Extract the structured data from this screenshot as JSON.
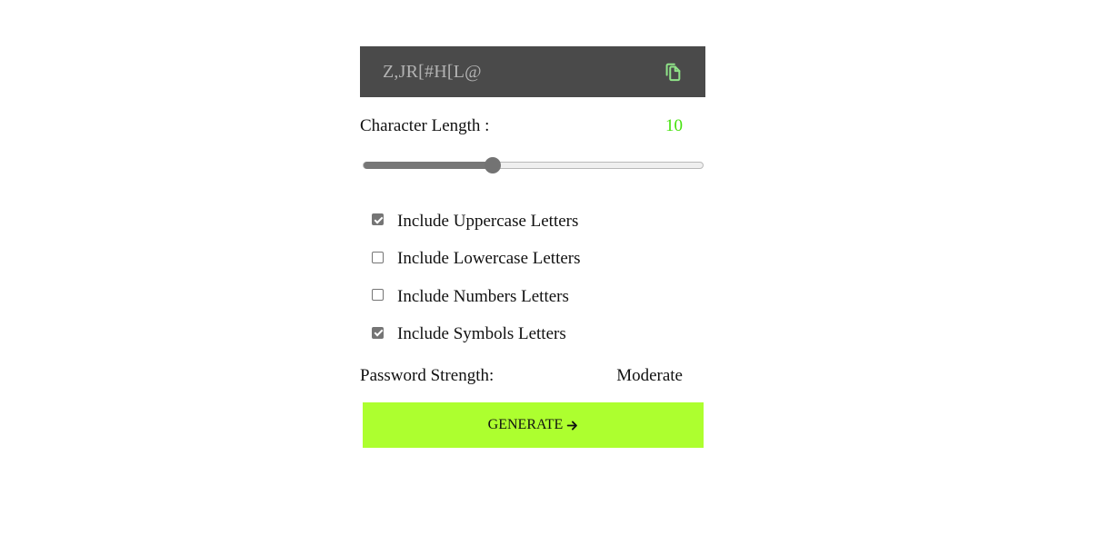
{
  "password": {
    "value": "Z,JR[#H[L@"
  },
  "copy": {
    "icon": "copy-icon",
    "color": "#8fe388"
  },
  "length": {
    "label": "Character Length :",
    "value": "10",
    "min": 1,
    "max": 25,
    "value_color": "#44e20c"
  },
  "options": [
    {
      "label": "Include Uppercase Letters",
      "checked": true
    },
    {
      "label": "Include Lowercase Letters",
      "checked": false
    },
    {
      "label": "Include Numbers Letters",
      "checked": false
    },
    {
      "label": "Include Symbols Letters",
      "checked": true
    }
  ],
  "strength": {
    "label": "Password Strength:",
    "value": "Moderate"
  },
  "generate": {
    "label": "GENERATE",
    "icon": "arrow-right-icon",
    "background": "#adff2f"
  }
}
